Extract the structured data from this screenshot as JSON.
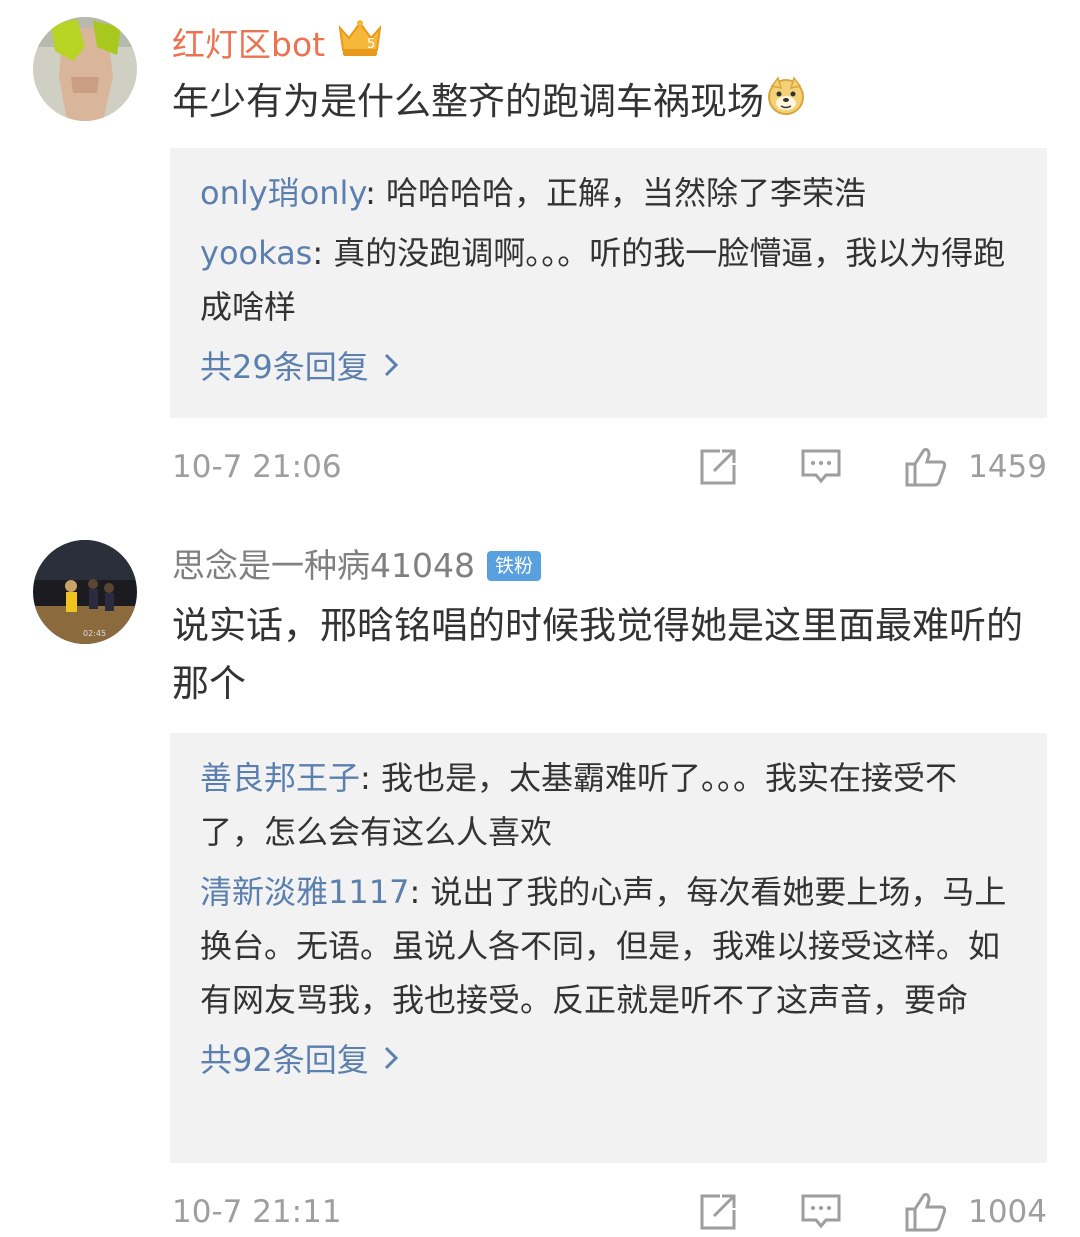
{
  "comments": [
    {
      "username": "红灯区bot",
      "crown_label": "5",
      "text": "年少有为是什么整齐的跑调车祸现场",
      "replies": [
        {
          "name": "only琑only",
          "sep": ": ",
          "text": "哈哈哈哈，正解，当然除了李荣浩"
        },
        {
          "name": "yookas",
          "sep": ": ",
          "text": "真的没跑调啊。。。听的我一脸懵逼，我以为得跑成啥样"
        }
      ],
      "more_label": "共29条回复",
      "time": "10-7 21:06",
      "likes": "1459"
    },
    {
      "username": "思念是一种病41048",
      "badge": "铁粉",
      "text": "说实话，邢晗铭唱的时候我觉得她是这里面最难听的那个",
      "avatar_overlay": "02:45",
      "replies": [
        {
          "name": "善良邦王子",
          "sep": ": ",
          "text": "我也是，太基霸难听了。。。我实在接受不了，怎么会有这么人喜欢"
        },
        {
          "name": "清新淡雅1117",
          "sep": ": ",
          "text": "说出了我的心声，每次看她要上场，马上换台。无语。虽说人各不同，但是，我难以接受这样。如有网友骂我，我也接受。反正就是听不了这声音，要命"
        }
      ],
      "more_label": "共92条回复",
      "time": "10-7 21:11",
      "likes": "1004"
    }
  ],
  "icons": {
    "share": "share-icon",
    "comment": "comment-icon",
    "like": "thumbs-up-icon",
    "crown": "crown-icon",
    "emoji": "doge-emoji-icon",
    "more": "chevron-right-icon"
  },
  "colors": {
    "username_highlight": "#eb7350",
    "reply_name": "#5b7fae",
    "reply_bg": "#f2f2f2",
    "meta_gray": "#9e9e9e",
    "badge_blue": "#58a0e0"
  }
}
